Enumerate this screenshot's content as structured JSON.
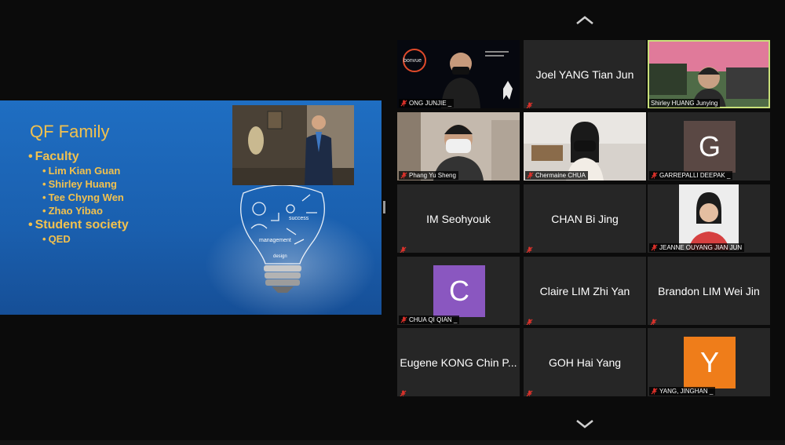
{
  "share": {
    "slide_title": "QF Family",
    "bullets": [
      {
        "text": "Faculty",
        "level": 1
      },
      {
        "text": "Lim Kian Guan",
        "level": 2
      },
      {
        "text": "Shirley Huang",
        "level": 2
      },
      {
        "text": "Tee Chyng Wen",
        "level": 2
      },
      {
        "text": "Zhao Yibao",
        "level": 2
      },
      {
        "text": "Student society",
        "level": 1
      },
      {
        "text": "QED",
        "level": 2
      }
    ],
    "doodle_words": [
      "management",
      "success",
      "design"
    ]
  },
  "participants": [
    {
      "name": "ONG JUNJIE _",
      "video": true,
      "muted": true,
      "banner": "bonvue"
    },
    {
      "name": "Joel YANG Tian Jun",
      "video": false,
      "muted": true
    },
    {
      "name": "Shirley HUANG Junying",
      "video": true,
      "muted": false,
      "active": true
    },
    {
      "name": "Phang Yu Sheng",
      "video": true,
      "muted": true
    },
    {
      "name": "Chermaine CHUA",
      "video": true,
      "muted": true
    },
    {
      "name": "GARREPALLI DEEPAK _",
      "video": false,
      "muted": true,
      "avatar_letter": "G",
      "avatar_color": "#5a4844"
    },
    {
      "name": "IM Seohyouk",
      "video": false,
      "muted": true
    },
    {
      "name": "CHAN Bi Jing",
      "video": false,
      "muted": true
    },
    {
      "name": "JEANNE OUYANG JIAN JUN",
      "video": true,
      "muted": true
    },
    {
      "name": "CHUA QI QIAN _",
      "video": false,
      "muted": true,
      "avatar_letter": "C",
      "avatar_color": "#8a57c0"
    },
    {
      "name": "Claire LIM Zhi Yan",
      "video": false,
      "muted": true
    },
    {
      "name": "Brandon LIM Wei Jin",
      "video": false,
      "muted": true
    },
    {
      "name": "Eugene KONG Chin P...",
      "video": false,
      "muted": true
    },
    {
      "name": "GOH Hai Yang",
      "video": false,
      "muted": true
    },
    {
      "name": "YANG, JINGHAN _",
      "video": false,
      "muted": true,
      "avatar_letter": "Y",
      "avatar_color": "#ef7d1a"
    }
  ],
  "colors": {
    "muted_icon": "#e0322b",
    "active_border": "#c8e07a",
    "slide_text": "#f2c14e"
  }
}
